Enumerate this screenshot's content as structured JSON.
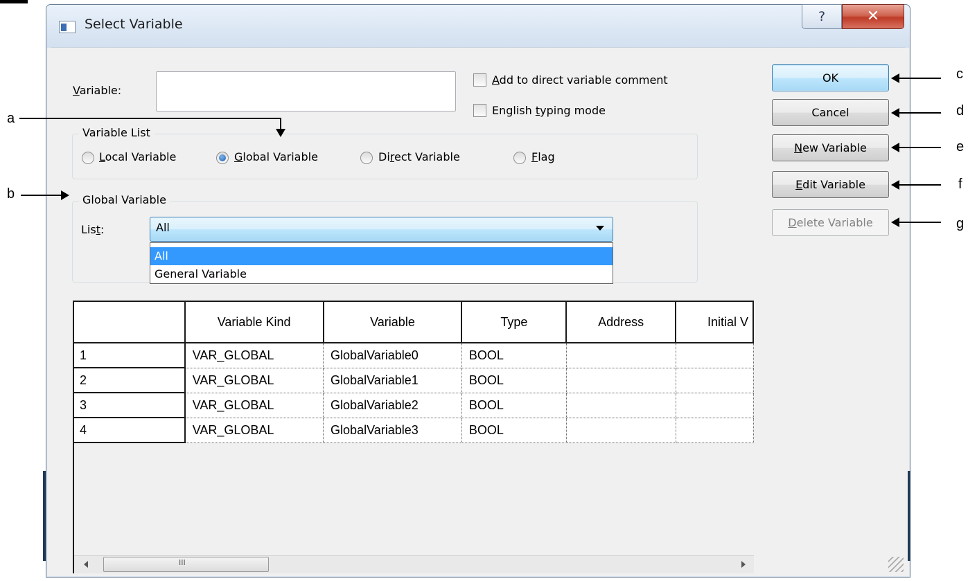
{
  "window": {
    "title": "Select Variable",
    "help_glyph": "?",
    "close_glyph": "✕"
  },
  "variable_field": {
    "label_prefix": "",
    "label_hot": "V",
    "label_rest": "ariable:",
    "value": ""
  },
  "checkboxes": [
    {
      "hot": "A",
      "rest": "dd to direct variable comment",
      "prefix": "",
      "checked": false
    },
    {
      "prefix": "English ",
      "hot": "t",
      "rest": "yping mode",
      "checked": false
    }
  ],
  "variable_list": {
    "title": "Variable List",
    "options": [
      {
        "prefix": "",
        "hot": "L",
        "rest": "ocal Variable",
        "selected": false
      },
      {
        "prefix": "",
        "hot": "G",
        "rest": "lobal Variable",
        "selected": true
      },
      {
        "prefix": "Di",
        "hot": "r",
        "rest": "ect Variable",
        "selected": false
      },
      {
        "prefix": "",
        "hot": "F",
        "rest": "lag",
        "selected": false
      }
    ]
  },
  "global_variable": {
    "title": "Global Variable",
    "list_label_prefix": "Lis",
    "list_label_hot": "t",
    "list_label_rest": ":",
    "selected": "All",
    "options": [
      "All",
      "General Variable"
    ]
  },
  "buttons": {
    "ok": "OK",
    "cancel": "Cancel",
    "new": {
      "hot": "N",
      "rest": "ew Variable"
    },
    "edit": {
      "hot": "E",
      "rest": "dit Variable"
    },
    "delete": {
      "hot": "D",
      "rest": "elete Variable"
    }
  },
  "table": {
    "columns": [
      "",
      "Variable Kind",
      "Variable",
      "Type",
      "Address",
      "Initial V"
    ],
    "rows": [
      [
        "1",
        "VAR_GLOBAL",
        "GlobalVariable0",
        "BOOL",
        "",
        ""
      ],
      [
        "2",
        "VAR_GLOBAL",
        "GlobalVariable1",
        "BOOL",
        "",
        ""
      ],
      [
        "3",
        "VAR_GLOBAL",
        "GlobalVariable2",
        "BOOL",
        "",
        ""
      ],
      [
        "4",
        "VAR_GLOBAL",
        "GlobalVariable3",
        "BOOL",
        "",
        ""
      ]
    ],
    "scroll_thumb_glyph": "III"
  },
  "callouts": {
    "a": "a",
    "b": "b",
    "c": "c",
    "d": "d",
    "e": "e",
    "f": "f",
    "g": "g"
  },
  "colors": {
    "selection": "#3399ff",
    "default_button_border": "#3c7fb1",
    "close_button": "#c74836"
  }
}
